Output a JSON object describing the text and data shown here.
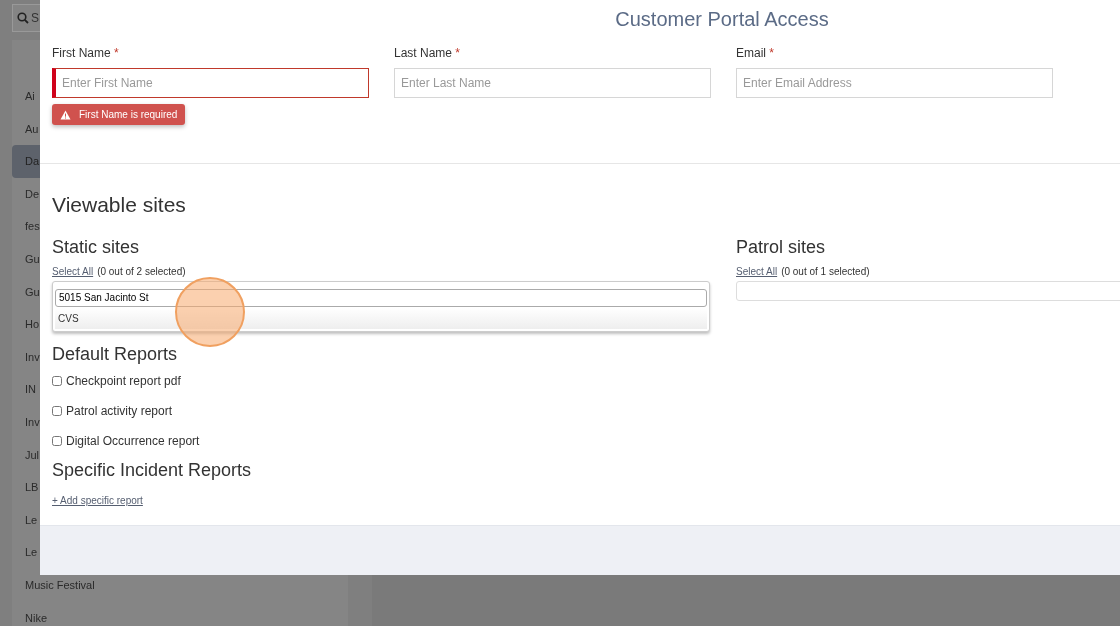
{
  "sidebar": {
    "search_placeholder": "S",
    "items": [
      {
        "label": "Ai",
        "selected": false
      },
      {
        "label": "Au",
        "selected": false
      },
      {
        "label": "Da",
        "selected": true
      },
      {
        "label": "De",
        "selected": false
      },
      {
        "label": "fes",
        "selected": false
      },
      {
        "label": "Gu",
        "selected": false
      },
      {
        "label": "Gu",
        "selected": false
      },
      {
        "label": "Ho",
        "selected": false
      },
      {
        "label": "Inv",
        "selected": false
      },
      {
        "label": "IN",
        "selected": false
      },
      {
        "label": "Inv",
        "selected": false
      },
      {
        "label": "Jul",
        "selected": false
      },
      {
        "label": "LB",
        "selected": false
      },
      {
        "label": "Le",
        "selected": false
      },
      {
        "label": "Le",
        "selected": false
      },
      {
        "label": "Music Festival",
        "selected": false
      },
      {
        "label": "Nike",
        "selected": false
      }
    ]
  },
  "modal": {
    "title": "Customer Portal Access",
    "fields": [
      {
        "label": "First Name",
        "required_mark": "*",
        "placeholder": "Enter First Name",
        "error": "First Name is required"
      },
      {
        "label": "Last Name",
        "required_mark": "*",
        "placeholder": "Enter Last Name"
      },
      {
        "label": "Email",
        "required_mark": "*",
        "placeholder": "Enter Email Address"
      }
    ],
    "viewable_title": "Viewable sites",
    "site_groups": [
      {
        "title": "Static sites",
        "select_all": "Select All",
        "count": "(0 out of 2 selected)",
        "open": true,
        "search_value": "5015 San Jacinto St",
        "options": [
          "CVS"
        ]
      },
      {
        "title": "Patrol sites",
        "select_all": "Select All",
        "count": "(0 out of 1 selected)",
        "open": false
      }
    ],
    "default_reports": {
      "title": "Default Reports",
      "items": [
        {
          "label": "Checkpoint report pdf",
          "checked": false
        },
        {
          "label": "Patrol activity report",
          "checked": false
        },
        {
          "label": "Digital Occurrence report",
          "checked": false
        }
      ]
    },
    "incident_reports": {
      "title": "Specific Incident Reports",
      "add_link": "+ Add specific report"
    }
  }
}
